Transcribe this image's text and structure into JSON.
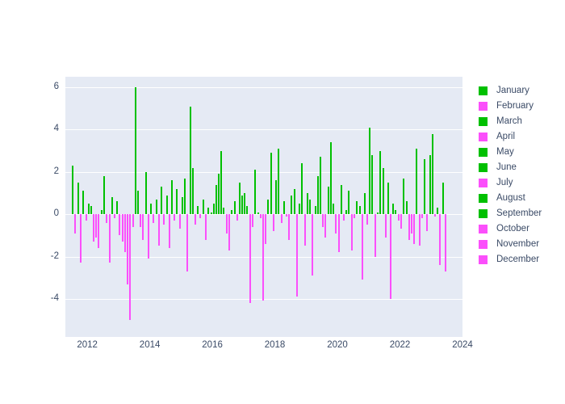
{
  "chart_data": {
    "type": "bar",
    "title": "",
    "subtitle": "",
    "xlabel": "",
    "ylabel": "",
    "xlim": [
      2011.3,
      2024.0
    ],
    "ylim": [
      -5.8,
      6.5
    ],
    "xticks": [
      2012,
      2014,
      2016,
      2018,
      2020,
      2022,
      2024
    ],
    "yticks": [
      6,
      4,
      2,
      0,
      -2,
      -4
    ],
    "grid": true,
    "grid_axis": "y",
    "legend_position": "right",
    "positive_color": "#00c000",
    "negative_color": "#fb4ffb",
    "plot_background": "#e5eaf4",
    "figure_background": "#ffffff",
    "tick_color": "#3a4a66",
    "legend": [
      {
        "label": "January",
        "color": "#00c000"
      },
      {
        "label": "February",
        "color": "#fb4ffb"
      },
      {
        "label": "March",
        "color": "#00c000"
      },
      {
        "label": "April",
        "color": "#fb4ffb"
      },
      {
        "label": "May",
        "color": "#00c000"
      },
      {
        "label": "June",
        "color": "#00c000"
      },
      {
        "label": "July",
        "color": "#fb4ffb"
      },
      {
        "label": "August",
        "color": "#00c000"
      },
      {
        "label": "September",
        "color": "#00c000"
      },
      {
        "label": "October",
        "color": "#fb4ffb"
      },
      {
        "label": "November",
        "color": "#fb4ffb"
      },
      {
        "label": "December",
        "color": "#fb4ffb"
      }
    ],
    "x": [
      2011.54,
      2011.62,
      2011.71,
      2011.79,
      2011.87,
      2011.96,
      2012.04,
      2012.12,
      2012.21,
      2012.29,
      2012.37,
      2012.46,
      2012.54,
      2012.62,
      2012.71,
      2012.79,
      2012.87,
      2012.96,
      2013.04,
      2013.12,
      2013.21,
      2013.29,
      2013.37,
      2013.46,
      2013.54,
      2013.62,
      2013.71,
      2013.79,
      2013.87,
      2013.96,
      2014.04,
      2014.12,
      2014.21,
      2014.29,
      2014.37,
      2014.46,
      2014.54,
      2014.62,
      2014.71,
      2014.79,
      2014.87,
      2014.96,
      2015.04,
      2015.12,
      2015.21,
      2015.29,
      2015.37,
      2015.46,
      2015.54,
      2015.62,
      2015.71,
      2015.79,
      2015.87,
      2015.96,
      2016.04,
      2016.12,
      2016.21,
      2016.29,
      2016.37,
      2016.46,
      2016.54,
      2016.62,
      2016.71,
      2016.79,
      2016.87,
      2016.96,
      2017.04,
      2017.12,
      2017.21,
      2017.29,
      2017.37,
      2017.46,
      2017.54,
      2017.62,
      2017.71,
      2017.79,
      2017.87,
      2017.96,
      2018.04,
      2018.12,
      2018.21,
      2018.29,
      2018.37,
      2018.46,
      2018.54,
      2018.62,
      2018.71,
      2018.79,
      2018.87,
      2018.96,
      2019.04,
      2019.12,
      2019.21,
      2019.29,
      2019.37,
      2019.46,
      2019.54,
      2019.62,
      2019.71,
      2019.79,
      2019.87,
      2019.96,
      2020.04,
      2020.12,
      2020.21,
      2020.29,
      2020.37,
      2020.46,
      2020.54,
      2020.62,
      2020.71,
      2020.79,
      2020.87,
      2020.96,
      2021.04,
      2021.12,
      2021.21,
      2021.29,
      2021.37,
      2021.46,
      2021.54,
      2021.62,
      2021.71,
      2021.79,
      2021.87,
      2021.96,
      2022.04,
      2022.12,
      2022.21,
      2022.29,
      2022.37,
      2022.46,
      2022.54,
      2022.62,
      2022.71,
      2022.79,
      2022.87,
      2022.96,
      2023.04,
      2023.12,
      2023.21,
      2023.29,
      2023.37,
      2023.46
    ],
    "values": [
      2.3,
      -0.9,
      1.5,
      -2.3,
      1.1,
      -0.3,
      0.5,
      0.4,
      -1.3,
      -1.1,
      -1.6,
      0.2,
      1.8,
      -0.4,
      -2.3,
      0.8,
      -0.2,
      0.6,
      -1.0,
      -1.3,
      -1.8,
      -3.3,
      -5.0,
      -0.6,
      6.0,
      1.1,
      -0.6,
      -1.2,
      2.0,
      -2.1,
      0.5,
      -0.4,
      0.7,
      -1.5,
      1.3,
      -0.5,
      0.9,
      -1.6,
      1.6,
      -0.3,
      1.2,
      -0.7,
      0.8,
      1.7,
      -2.7,
      5.1,
      2.2,
      -0.5,
      0.4,
      -0.2,
      0.7,
      -1.2,
      0.3,
      0.1,
      0.5,
      1.4,
      1.9,
      3.0,
      0.3,
      -0.9,
      -1.7,
      0.2,
      0.6,
      -0.3,
      1.5,
      0.9,
      1.0,
      0.4,
      -4.2,
      -0.6,
      2.1,
      0.1,
      -0.2,
      -4.1,
      -1.4,
      0.7,
      2.9,
      -0.8,
      1.6,
      3.1,
      -0.4,
      0.6,
      -0.1,
      -1.2,
      0.9,
      1.2,
      -3.9,
      0.5,
      2.4,
      -1.5,
      1.0,
      0.7,
      -2.9,
      0.4,
      1.8,
      2.7,
      -0.6,
      -1.1,
      1.3,
      3.4,
      0.5,
      -0.9,
      -1.8,
      1.4,
      -0.3,
      0.2,
      1.1,
      -1.7,
      -0.2,
      0.6,
      0.4,
      -3.1,
      1.0,
      -0.5,
      4.1,
      2.8,
      -2.0,
      0.1,
      3.0,
      2.2,
      -1.1,
      1.5,
      -4.0,
      0.5,
      0.2,
      -0.3,
      -0.7,
      1.7,
      0.6,
      -1.2,
      -0.9,
      -1.4,
      3.1,
      -1.5,
      -0.2,
      2.6,
      -0.8,
      2.8,
      3.8,
      -0.1,
      0.3,
      -2.4,
      1.5,
      -2.7
    ],
    "months": [
      "July",
      "August",
      "September",
      "October",
      "November",
      "December",
      "January",
      "February",
      "March",
      "April",
      "May",
      "June",
      "July",
      "August",
      "September",
      "October",
      "November",
      "December",
      "January",
      "February",
      "March",
      "April",
      "May",
      "June",
      "July",
      "August",
      "September",
      "October",
      "November",
      "December",
      "January",
      "February",
      "March",
      "April",
      "May",
      "June",
      "July",
      "August",
      "September",
      "October",
      "November",
      "December",
      "January",
      "February",
      "March",
      "April",
      "May",
      "June",
      "July",
      "August",
      "September",
      "October",
      "November",
      "December",
      "January",
      "February",
      "March",
      "April",
      "May",
      "June",
      "July",
      "August",
      "September",
      "October",
      "November",
      "December",
      "January",
      "February",
      "March",
      "April",
      "May",
      "June",
      "July",
      "August",
      "September",
      "October",
      "November",
      "December",
      "January",
      "February",
      "March",
      "April",
      "May",
      "June",
      "July",
      "August",
      "September",
      "October",
      "November",
      "December",
      "January",
      "February",
      "March",
      "April",
      "May",
      "June",
      "July",
      "August",
      "September",
      "October",
      "November",
      "December",
      "January",
      "February",
      "March",
      "April",
      "May",
      "June",
      "July",
      "August",
      "September",
      "October",
      "November",
      "December",
      "January",
      "February",
      "March",
      "April",
      "May",
      "June",
      "July",
      "August",
      "September",
      "October",
      "November",
      "December",
      "January",
      "February",
      "March",
      "April",
      "May",
      "June",
      "July",
      "August",
      "September",
      "October",
      "November",
      "December",
      "January",
      "February",
      "March",
      "April",
      "May",
      "June"
    ]
  }
}
